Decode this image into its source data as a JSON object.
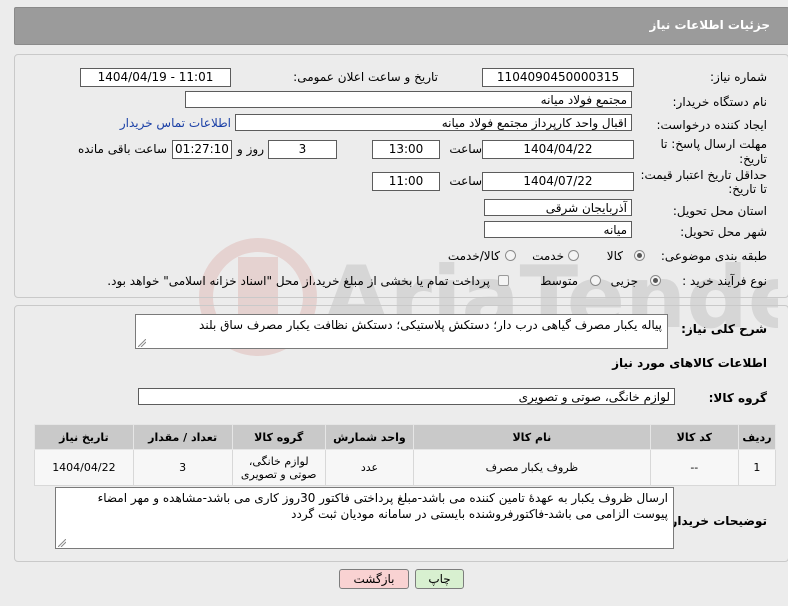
{
  "header": {
    "title": "جزئیات اطلاعات نیاز"
  },
  "labels": {
    "need_number": "شماره نیاز:",
    "announce_datetime": "تاریخ و ساعت اعلان عمومی:",
    "buyer_org": "نام دستگاه خریدار:",
    "requester": "ایجاد کننده درخواست:",
    "reply_deadline_line1": "مهلت ارسال پاسخ: تا",
    "reply_deadline_line2": "تاریخ:",
    "price_validity_line1": "حداقل تاریخ اعتبار قیمت:",
    "price_validity_line2": "تا تاریخ:",
    "hour": "ساعت",
    "day_and": "روز و",
    "remaining": "ساعت باقی مانده",
    "province": "استان محل تحویل:",
    "city": "شهر محل تحویل:",
    "subject_class": "طبقه بندی موضوعی:",
    "purchase_type": "نوع فرآیند خرید :",
    "general_desc": "شرح کلی نیاز:",
    "goods_info": "اطلاعات کالاهای مورد نیاز",
    "goods_group": "گروه کالا:",
    "buyer_notes": "توضیحات خریدار:"
  },
  "values": {
    "need_number": "1104090450000315",
    "announce_datetime": "1404/04/19 - 11:01",
    "buyer_org": "مجتمع فولاد میانه",
    "requester": "اقبال واحد کارپرداز مجتمع فولاد میانه",
    "buyer_contact_link": "اطلاعات تماس خریدار",
    "reply_date": "1404/04/22",
    "reply_time": "13:00",
    "reply_days": "3",
    "reply_remaining": "01:27:10",
    "validity_date": "1404/07/22",
    "validity_time": "11:00",
    "province": "آذربایجان شرقی",
    "city": "میانه",
    "general_desc": "پیاله یکبار مصرف گیاهی درب دار؛ دستکش پلاستیکی؛ دستکش نظافت یکبار مصرف ساق بلند",
    "goods_group": "لوازم خانگی، صوتی و تصویری",
    "buyer_notes": "ارسال ظروف یکبار به عهدهٔ تامین کننده می باشد-مبلغ پرداختی فاکتور 30روز کاری می باشد-مشاهده و مهر امضاء پیوست الزامی می باشد-فاکتورفروشنده بایستی در سامانه مودیان ثبت گردد"
  },
  "subject_options": [
    {
      "label": "کالا",
      "selected": true
    },
    {
      "label": "خدمت",
      "selected": false
    },
    {
      "label": "کالا/خدمت",
      "selected": false
    }
  ],
  "purchase_options": [
    {
      "label": "جزیی",
      "selected": true
    },
    {
      "label": "متوسط",
      "selected": false
    }
  ],
  "payment_note": "پرداخت تمام یا بخشی از مبلغ خرید،از محل \"اسناد خزانه اسلامی\" خواهد بود.",
  "table": {
    "headers": [
      "ردیف",
      "کد کالا",
      "نام کالا",
      "واحد شمارش",
      "گروه کالا",
      "تعداد / مقدار",
      "تاریخ نیاز"
    ],
    "rows": [
      [
        "1",
        "--",
        "ظروف یکبار مصرف",
        "عدد",
        "لوازم خانگی، صوتی و تصویری",
        "3",
        "1404/04/22"
      ]
    ]
  },
  "buttons": {
    "print": "چاپ",
    "back": "بازگشت"
  },
  "colors": {
    "header_bg": "#9b9b9b",
    "link": "#1a3fa6",
    "back_btn": "#f9d2d2",
    "print_btn": "#d8f0d0"
  }
}
